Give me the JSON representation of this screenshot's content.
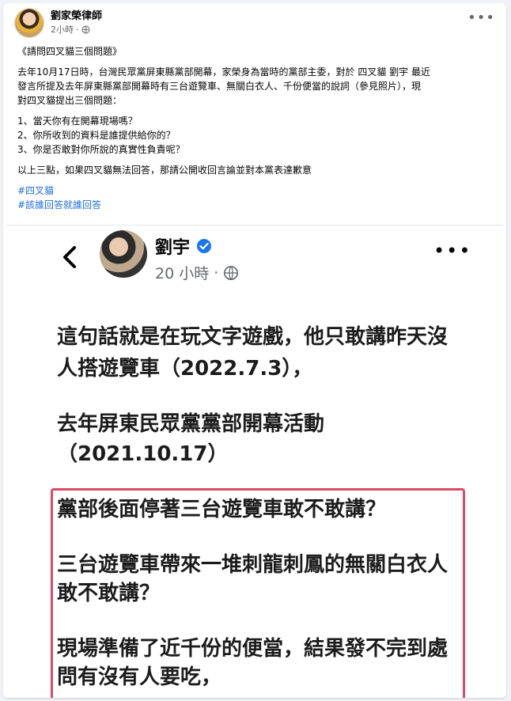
{
  "post": {
    "author": "劉家榮律師",
    "time": "2小時",
    "lines": [
      "《請問四叉貓三個問題》",
      "去年10月17日時，台灣民眾黨屏東縣黨部開幕，家榮身為當時的黨部主委，對於 四叉貓 劉宇 最近",
      "發言所提及去年屏東縣黨部開幕時有三台遊覽車、無關白衣人、千份便當的說詞（參見照片），現",
      "對四叉貓提出三個問題：",
      "1、當天你有在開幕現場嗎？",
      "2、你所收到的資料是誰提供給你的？",
      "3、你是否敢對你所說的真實性負責呢？",
      "以上三點，如果四叉貓無法回答，那請公開收回言論並對本黨表達歉意"
    ],
    "hashtags": [
      "#四叉貓",
      "#該誰回答就誰回答"
    ]
  },
  "screenshot": {
    "author": "劉宇",
    "time": "20 小時",
    "lines": [
      "這句話就是在玩文字遊戲，他只敢講昨天沒",
      "人搭遊覽車（2022.7.3），",
      "去年屏東民眾黨黨部開幕活動",
      "（2021.10.17）",
      "黨部後面停著三台遊覽車敢不敢講？",
      "三台遊覽車帶來一堆刺龍刺鳳的無關白衣人",
      "敢不敢講？",
      "現場準備了近千份的便當，結果發不完到處",
      "問有沒有人要吃，"
    ]
  },
  "icons": {
    "more": "more-horizontal-icon",
    "globe": "globe-icon",
    "back": "back-arrow-icon",
    "verified": "verified-badge-icon"
  },
  "colors": {
    "hashtag": "#216fdb",
    "highlight_border": "#d94a63",
    "verified": "#1877f2"
  }
}
